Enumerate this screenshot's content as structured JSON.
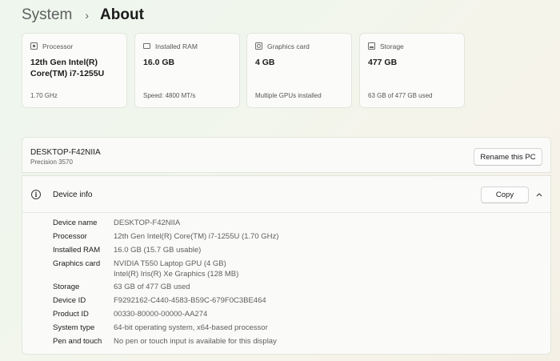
{
  "breadcrumb": {
    "parent": "System",
    "separator": "›",
    "current": "About"
  },
  "cards": [
    {
      "label": "Processor",
      "icon": "processor-icon",
      "value": "12th Gen Intel(R) Core(TM) i7-1255U",
      "sub": "1.70 GHz"
    },
    {
      "label": "Installed RAM",
      "icon": "ram-icon",
      "value": "16.0 GB",
      "sub": "Speed: 4800 MT/s"
    },
    {
      "label": "Graphics card",
      "icon": "gpu-icon",
      "value": "4 GB",
      "sub": "Multiple GPUs installed"
    },
    {
      "label": "Storage",
      "icon": "storage-icon",
      "value": "477 GB",
      "sub": "63 GB of 477 GB used"
    }
  ],
  "pc": {
    "name": "DESKTOP-F42NIIA",
    "model": "Precision 3570",
    "rename_label": "Rename this PC"
  },
  "device_info": {
    "title": "Device info",
    "copy_label": "Copy",
    "specs": [
      {
        "label": "Device name",
        "value": "DESKTOP-F42NIIA"
      },
      {
        "label": "Processor",
        "value": "12th Gen Intel(R) Core(TM) i7-1255U (1.70 GHz)"
      },
      {
        "label": "Installed RAM",
        "value": "16.0 GB (15.7 GB usable)"
      },
      {
        "label": "Graphics card",
        "value": "NVIDIA T550 Laptop GPU (4 GB)",
        "value2": "Intel(R) Iris(R) Xe Graphics (128 MB)"
      },
      {
        "label": "Storage",
        "value": "63 GB of 477 GB used"
      },
      {
        "label": "Device ID",
        "value": "F9292162-C440-4583-B59C-679F0C3BE464"
      },
      {
        "label": "Product ID",
        "value": "00330-80000-00000-AA274"
      },
      {
        "label": "System type",
        "value": "64-bit operating system, x64-based processor"
      },
      {
        "label": "Pen and touch",
        "value": "No pen or touch input is available for this display"
      }
    ]
  }
}
